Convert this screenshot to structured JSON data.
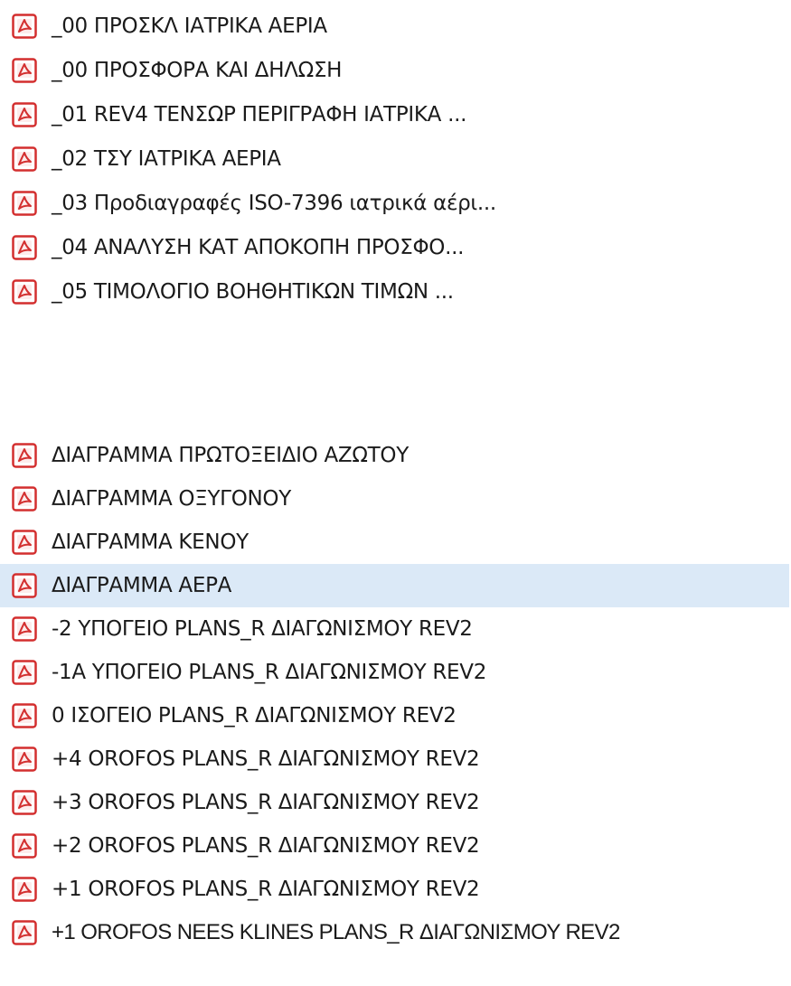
{
  "files": {
    "group1": [
      {
        "name": "_00 ΠΡΟΣΚΛ ΙΑΤΡΙΚΑ ΑΕΡΙΑ",
        "icon": "pdf-file-icon"
      },
      {
        "name": "_00 ΠΡΟΣΦΟΡΑ ΚΑΙ ΔΗΛΩΣΗ",
        "icon": "pdf-file-icon"
      },
      {
        "name": "_01  REV4  ΤΕΝΣΩΡ ΠΕΡΙΓΡΑΦΗ ΙΑΤΡΙΚΑ ...",
        "icon": "pdf-file-icon"
      },
      {
        "name": "_02 ΤΣΥ ΙΑΤΡΙΚΑ ΑΕΡΙΑ",
        "icon": "pdf-file-icon"
      },
      {
        "name": "_03 Προδιαγραφές ISO-7396 ιατρικά αέρι...",
        "icon": "pdf-file-icon"
      },
      {
        "name": "_04 ΑΝΑΛΥΣΗ ΚΑΤ ΑΠΟΚΟΠΗ ΠΡΟΣΦΟ...",
        "icon": "pdf-file-icon"
      },
      {
        "name": "_05 ΤΙΜΟΛΟΓΙΟ ΒΟΗΘΗΤΙΚΩΝ ΤΙΜΩΝ ...",
        "icon": "pdf-file-icon"
      }
    ],
    "group2": [
      {
        "name": "ΔΙΑΓΡΑΜΜΑ ΠΡΩΤΟΞΕΙΔΙΟ ΑΖΩΤΟΥ",
        "icon": "pdf-file-icon"
      },
      {
        "name": "ΔΙΑΓΡΑΜΜΑ ΟΞΥΓΟΝΟΥ",
        "icon": "pdf-file-icon"
      },
      {
        "name": "ΔΙΑΓΡΑΜΜΑ ΚΕΝΟΥ",
        "icon": "pdf-file-icon"
      },
      {
        "name": "ΔΙΑΓΡΑΜΜΑ ΑΕΡΑ",
        "icon": "pdf-file-icon",
        "selected": true
      },
      {
        "name": "-2 ΥΠΟΓΕΙΟ PLANS_R  ΔΙΑΓΩΝΙΣΜΟΥ REV2",
        "icon": "pdf-file-icon"
      },
      {
        "name": "-1Α ΥΠΟΓΕΙΟ PLANS_R  ΔΙΑΓΩΝΙΣΜΟΥ REV2",
        "icon": "pdf-file-icon"
      },
      {
        "name": "0 ΙΣΟΓΕΙΟ PLANS_R  ΔΙΑΓΩΝΙΣΜΟΥ REV2",
        "icon": "pdf-file-icon"
      },
      {
        "name": "+4 OROFOS PLANS_R  ΔΙΑΓΩΝΙΣΜΟΥ REV2",
        "icon": "pdf-file-icon"
      },
      {
        "name": "+3 OROFOS PLANS_R  ΔΙΑΓΩΝΙΣΜΟΥ REV2",
        "icon": "pdf-file-icon"
      },
      {
        "name": "+2 OROFOS PLANS_R  ΔΙΑΓΩΝΙΣΜΟΥ REV2",
        "icon": "pdf-file-icon"
      },
      {
        "name": "+1 OROFOS PLANS_R  ΔΙΑΓΩΝΙΣΜΟΥ REV2",
        "icon": "pdf-file-icon"
      },
      {
        "name": "+1  OROFOS  NEES KLINES PLANS_R  ΔΙΑΓΩΝΙΣΜΟΥ REV2",
        "icon": "pdf-file-icon"
      }
    ]
  },
  "colors": {
    "pdf_red": "#d32f2f",
    "selection_bg": "#dbe9f7"
  }
}
